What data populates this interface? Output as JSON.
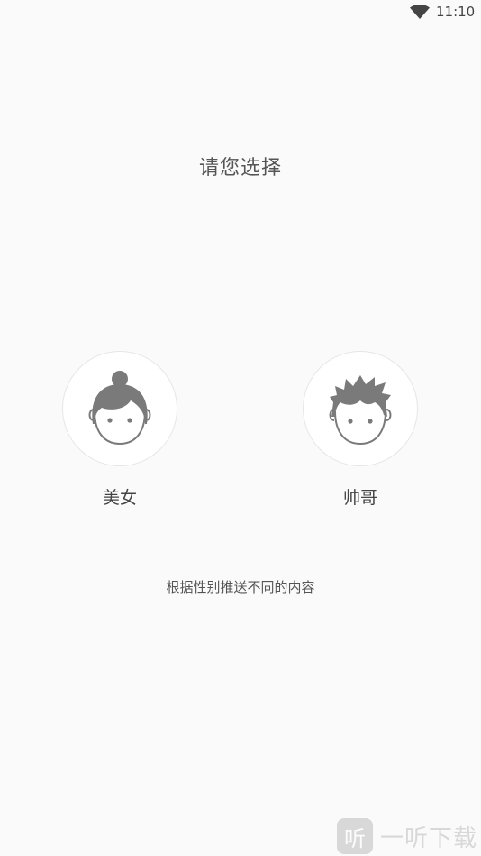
{
  "status_bar": {
    "time": "11:10",
    "wifi_icon": "wifi-icon"
  },
  "page": {
    "title": "请您选择",
    "subtitle": "根据性别推送不同的内容"
  },
  "choices": [
    {
      "label": "美女",
      "icon": "girl-avatar-icon"
    },
    {
      "label": "帅哥",
      "icon": "boy-avatar-icon"
    }
  ],
  "watermark": {
    "logo_glyph": "听",
    "text": "一听下载"
  },
  "colors": {
    "background": "#fafafa",
    "avatar_fill": "#7a7a7a",
    "text_primary": "#444444"
  }
}
